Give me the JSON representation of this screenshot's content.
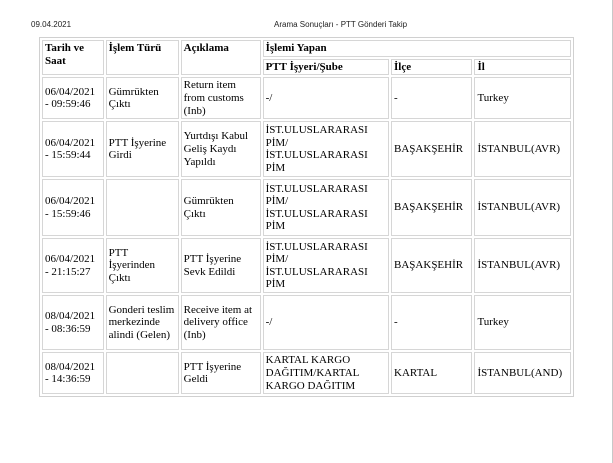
{
  "header": {
    "date": "09.04.2021",
    "title": "Arama Sonuçları - PTT Gönderi Takip"
  },
  "table": {
    "headers": {
      "date": "Tarih ve Saat",
      "type": "İşlem Türü",
      "desc": "Açıklama",
      "performer": "İşlemi Yapan",
      "place": "PTT İşyeri/Şube",
      "district": "İlçe",
      "province": "İl"
    },
    "rows": [
      {
        "date": "06/04/2021 - 09:59:46",
        "type": "Gümrükten Çıktı",
        "desc": "Return item from customs (Inb)",
        "place": "-/",
        "district": "-",
        "province": "Turkey"
      },
      {
        "date": "06/04/2021 - 15:59:44",
        "type": "PTT İşyerine Girdi",
        "desc": "Yurtdışı Kabul Geliş Kaydı Yapıldı",
        "place": "İST.ULUSLARARASI PİM/ İST.ULUSLARARASI PİM",
        "district": "BAŞAKŞEHİR",
        "province": "İSTANBUL(AVR)"
      },
      {
        "date": "06/04/2021 - 15:59:46",
        "type": "",
        "desc": "Gümrükten Çıktı",
        "place": "İST.ULUSLARARASI PİM/ İST.ULUSLARARASI PİM",
        "district": "BAŞAKŞEHİR",
        "province": "İSTANBUL(AVR)"
      },
      {
        "date": "06/04/2021 - 21:15:27",
        "type": "PTT İşyerinden Çıktı",
        "desc": "PTT İşyerine Sevk Edildi",
        "place": "İST.ULUSLARARASI PİM/ İST.ULUSLARARASI PİM",
        "district": "BAŞAKŞEHİR",
        "province": "İSTANBUL(AVR)"
      },
      {
        "date": "08/04/2021 - 08:36:59",
        "type": "Gonderi teslim merkezinde alindi (Gelen)",
        "desc": "Receive item at delivery office (Inb)",
        "place": "-/",
        "district": "-",
        "province": "Turkey"
      },
      {
        "date": "08/04/2021 - 14:36:59",
        "type": "",
        "desc": "PTT İşyerine Geldi",
        "place": "KARTAL KARGO DAĞITIM/KARTAL KARGO DAĞITIM",
        "district": "KARTAL",
        "province": "İSTANBUL(AND)"
      }
    ]
  }
}
